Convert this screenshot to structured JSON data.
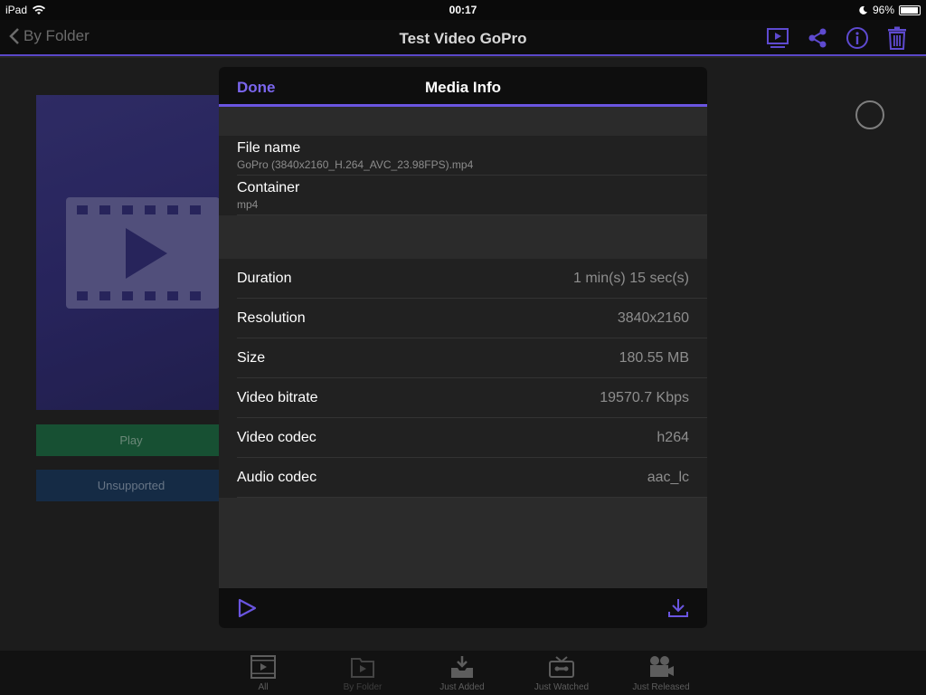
{
  "status_bar": {
    "device": "iPad",
    "time": "00:17",
    "battery": "96%",
    "battery_level": 0.96
  },
  "navbar": {
    "back_label": "By Folder",
    "title": "Test Video GoPro"
  },
  "background": {
    "play_button": "Play",
    "unsupported_button": "Unsupported"
  },
  "modal": {
    "done_label": "Done",
    "title": "Media Info",
    "file_name": {
      "label": "File name",
      "value": "GoPro (3840x2160_H.264_AVC_23.98FPS).mp4"
    },
    "container": {
      "label": "Container",
      "value": "mp4"
    },
    "details": [
      {
        "label": "Duration",
        "value": "1 min(s) 15 sec(s)"
      },
      {
        "label": "Resolution",
        "value": "3840x2160"
      },
      {
        "label": "Size",
        "value": "180.55 MB"
      },
      {
        "label": "Video bitrate",
        "value": "19570.7 Kbps"
      },
      {
        "label": "Video codec",
        "value": "h264"
      },
      {
        "label": "Audio codec",
        "value": "aac_lc"
      }
    ]
  },
  "tabbar": {
    "tabs": [
      {
        "label": "All",
        "icon": "film-icon"
      },
      {
        "label": "By Folder",
        "icon": "folder-play-icon"
      },
      {
        "label": "Just Added",
        "icon": "inbox-download-icon"
      },
      {
        "label": "Just Watched",
        "icon": "cassette-icon"
      },
      {
        "label": "Just Released",
        "icon": "movie-camera-icon"
      }
    ]
  },
  "colors": {
    "accent": "#6a55e0",
    "play_green": "#1f6b45",
    "unsupported_blue": "#1d3a5d"
  }
}
